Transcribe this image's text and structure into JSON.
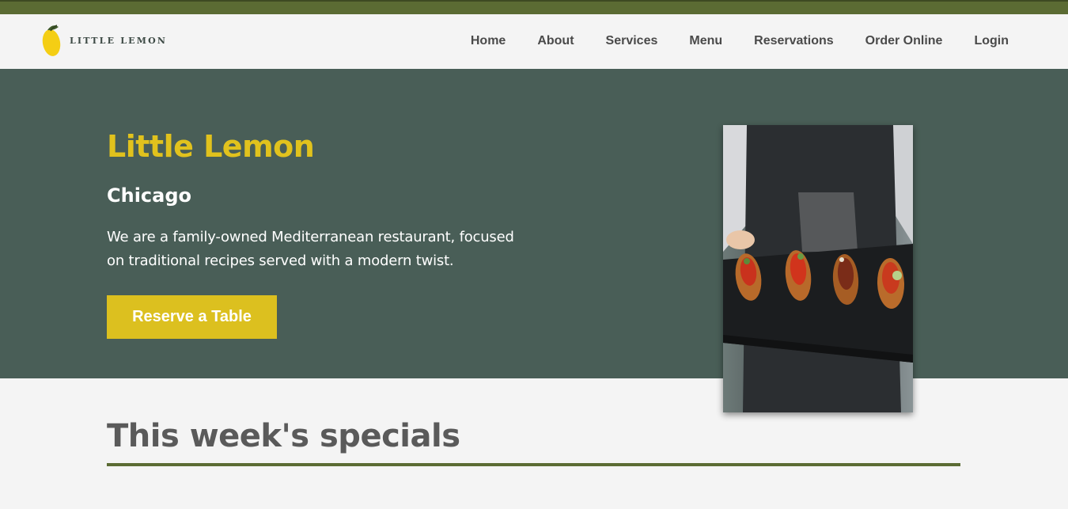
{
  "brand": {
    "logo_text": "LITTLE LEMON",
    "primary_color": "#495e57",
    "accent_color": "#e1c21d",
    "bar_color": "#5b6b33"
  },
  "nav": {
    "items": [
      {
        "label": "Home"
      },
      {
        "label": "About"
      },
      {
        "label": "Services"
      },
      {
        "label": "Menu"
      },
      {
        "label": "Reservations"
      },
      {
        "label": "Order Online"
      },
      {
        "label": "Login"
      }
    ]
  },
  "hero": {
    "title": "Little Lemon",
    "city": "Chicago",
    "description": "We are a family-owned Mediterranean restaurant, focused on traditional recipes served with a modern twist.",
    "button_label": "Reserve a Table"
  },
  "specials": {
    "title": "This week's specials"
  }
}
